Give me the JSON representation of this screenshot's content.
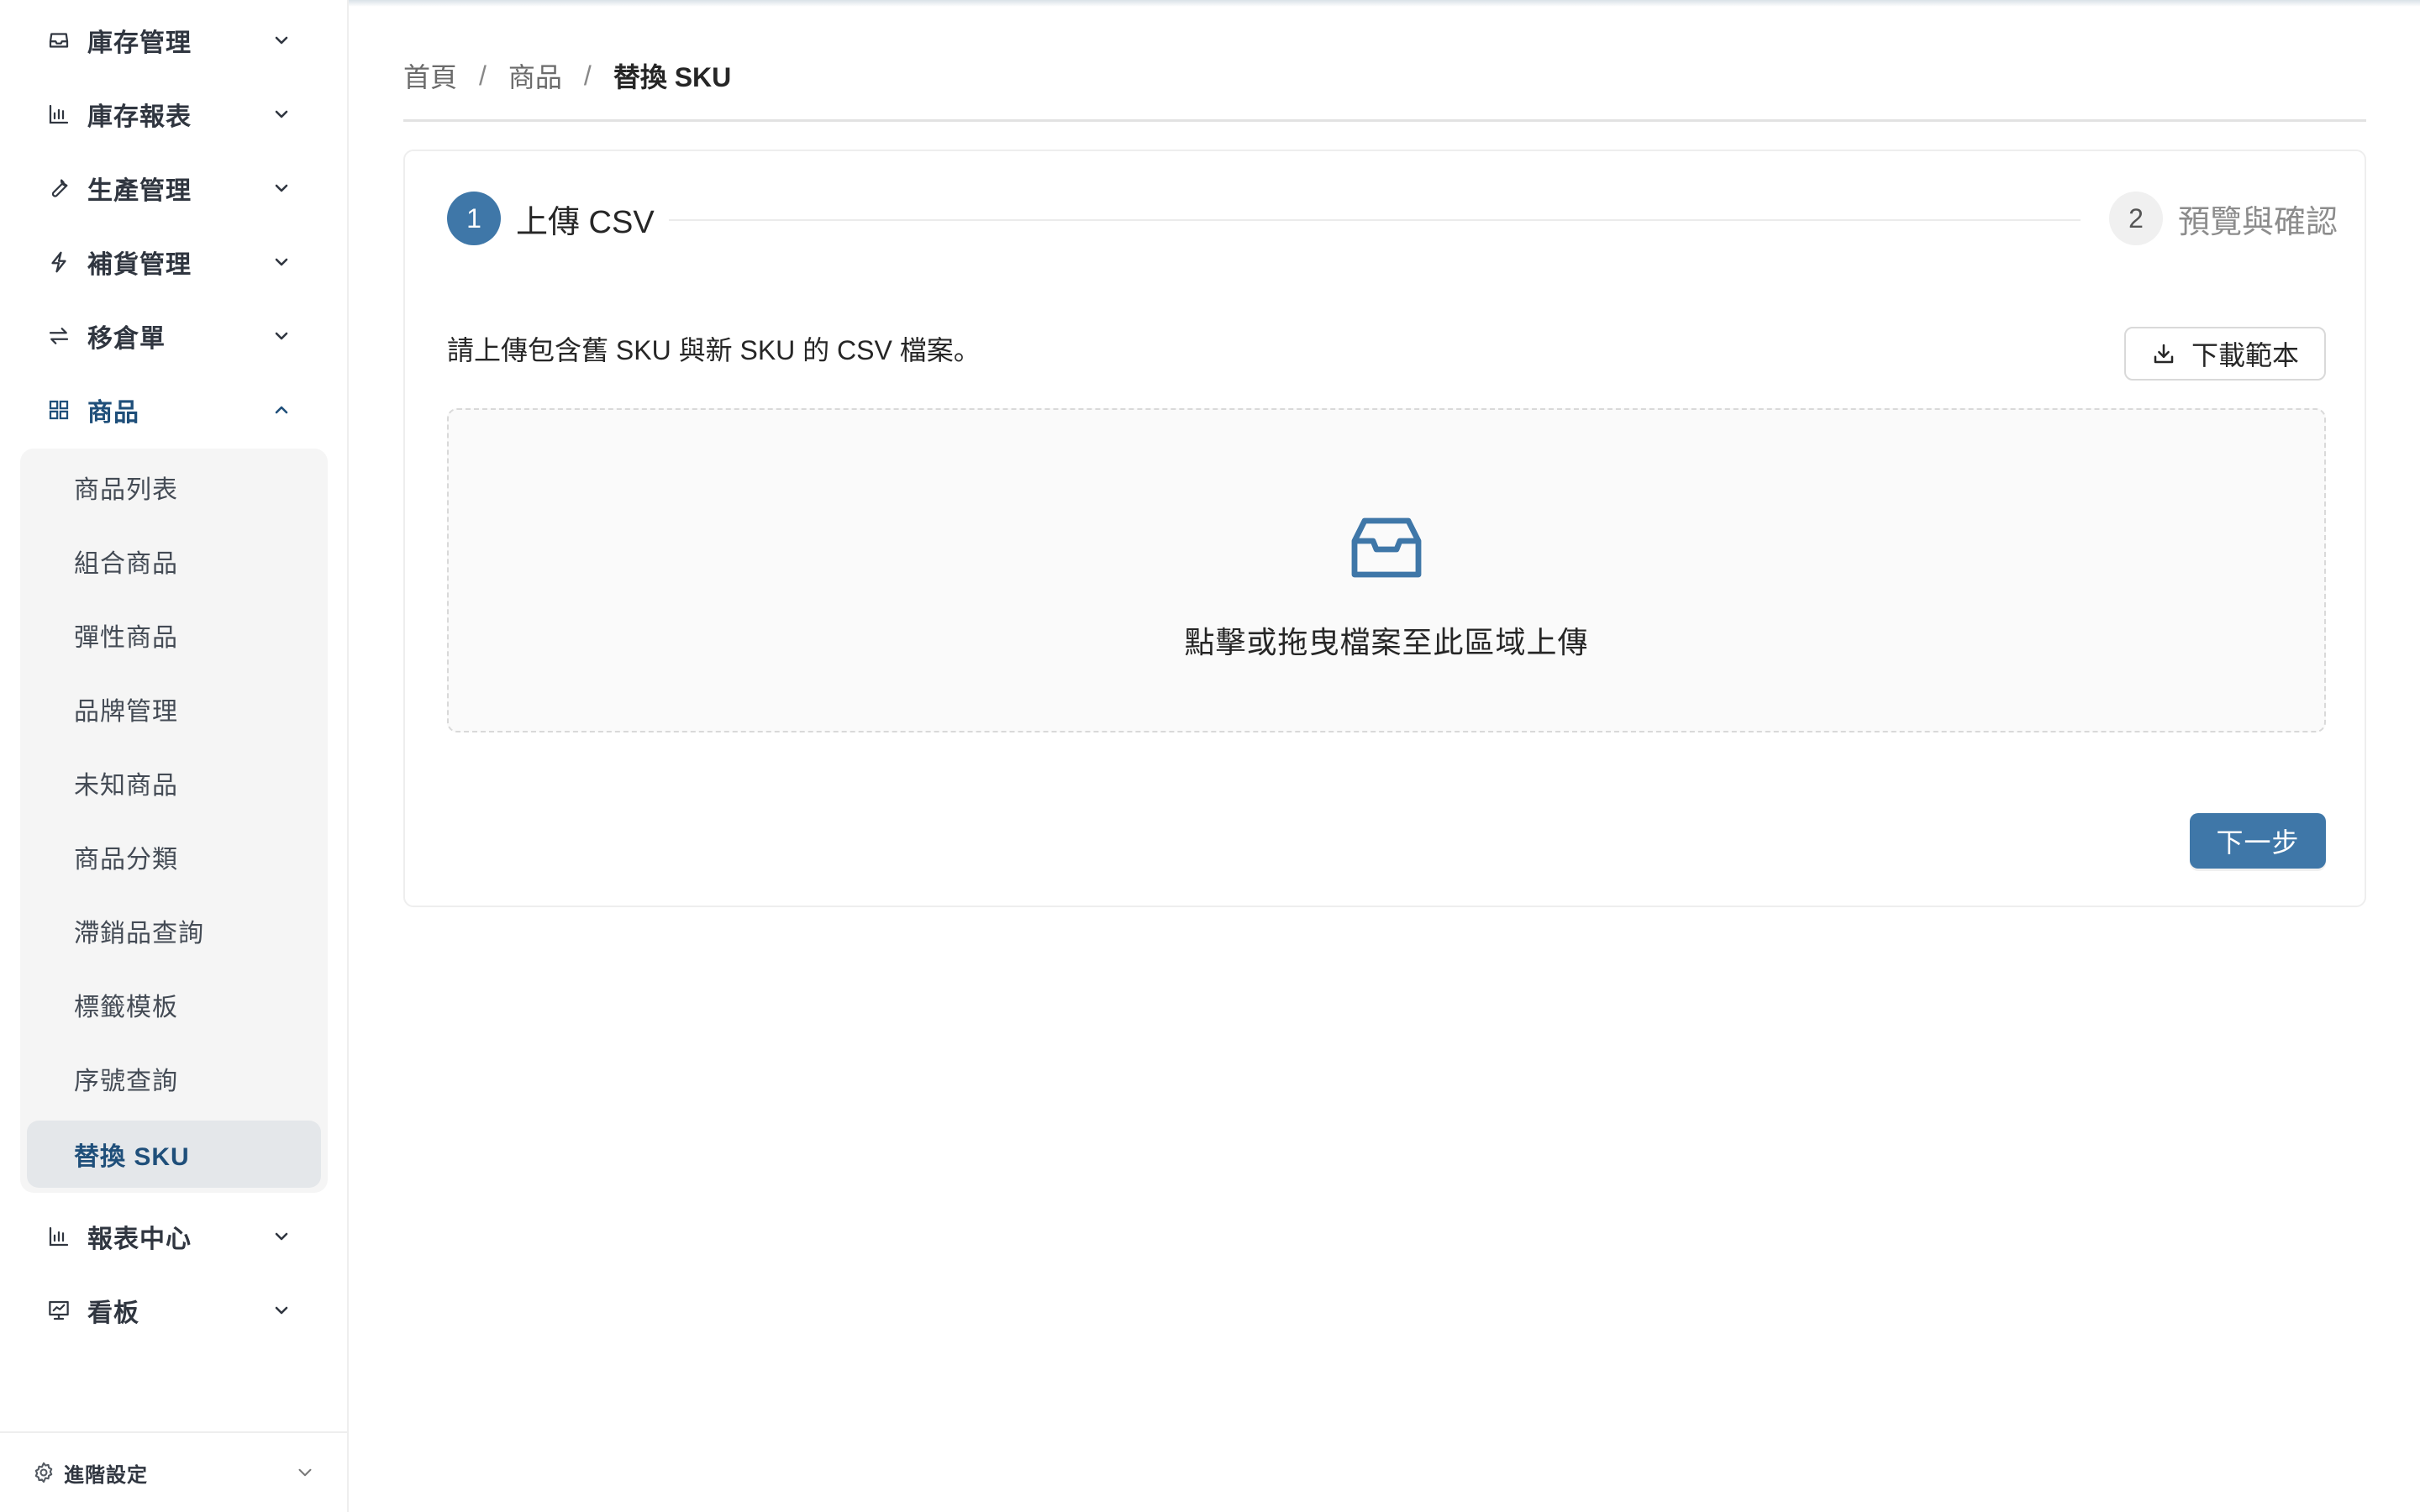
{
  "sidebar": {
    "menu": [
      {
        "label": "庫存管理",
        "icon": "inbox-icon",
        "expanded": false
      },
      {
        "label": "庫存報表",
        "icon": "bar-chart-icon",
        "expanded": false
      },
      {
        "label": "生產管理",
        "icon": "wrench-icon",
        "expanded": false
      },
      {
        "label": "補貨管理",
        "icon": "lightning-icon",
        "expanded": false
      },
      {
        "label": "移倉單",
        "icon": "swap-icon",
        "expanded": false
      },
      {
        "label": "商品",
        "icon": "grid-icon",
        "expanded": true
      },
      {
        "label": "報表中心",
        "icon": "bar-chart-icon",
        "expanded": false
      },
      {
        "label": "看板",
        "icon": "dashboard-icon",
        "expanded": false
      }
    ],
    "submenu": [
      {
        "label": "商品列表"
      },
      {
        "label": "組合商品"
      },
      {
        "label": "彈性商品"
      },
      {
        "label": "品牌管理"
      },
      {
        "label": "未知商品"
      },
      {
        "label": "商品分類"
      },
      {
        "label": "滯銷品查詢"
      },
      {
        "label": "標籤模板"
      },
      {
        "label": "序號查詢"
      },
      {
        "label": "替換 SKU",
        "selected": true
      }
    ],
    "advanced_label": "進階設定"
  },
  "breadcrumb": {
    "items": [
      "首頁",
      "商品",
      "替換 SKU"
    ],
    "separator": "/"
  },
  "steps": [
    {
      "number": "1",
      "title": "上傳 CSV",
      "status": "active"
    },
    {
      "number": "2",
      "title": "預覽與確認",
      "status": "waiting"
    }
  ],
  "upload": {
    "instruction": "請上傳包含舊 SKU 與新 SKU 的 CSV 檔案。",
    "download_label": "下載範本",
    "dropzone_text": "點擊或拖曳檔案至此區域上傳",
    "next_label": "下一步"
  },
  "colors": {
    "primary": "#3f77a8",
    "active_text": "#1f4f7a",
    "selected_bg": "#e4e7ea",
    "submenu_bg": "#f5f5f5"
  }
}
